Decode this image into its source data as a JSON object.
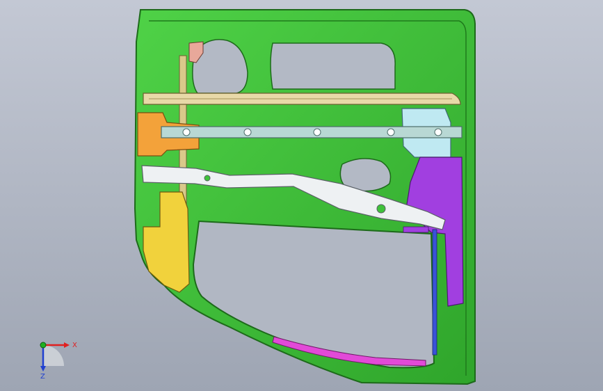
{
  "scene": {
    "background_top": "#c3c8d4",
    "background_bottom": "#9ea5b3",
    "door_inner_panel_color": "#3fc23a",
    "door_frame_color": "#2e9b2a",
    "crossbar_upper_color": "#e8d9a8",
    "crossbar_middle_color": "#b8d8d4",
    "reinforcement_orange_color": "#f3a23a",
    "reinforcement_yellow_color": "#f1d23c",
    "hinge_pillar_purple_color": "#a13fe0",
    "bracket_lightblue_color": "#bfe9f2",
    "beam_white_color": "#eef1f3",
    "lower_seal_magenta_color": "#e24ad8",
    "bracket_pink_color": "#e8a89a"
  },
  "triad": {
    "x_label": "X",
    "z_label": "Z",
    "x_icon": "x-axis-arrow-icon",
    "y_icon": "y-axis-dot-icon",
    "z_icon": "z-axis-arrow-icon",
    "x_color": "#e02020",
    "y_color": "#20b020",
    "z_color": "#2040d0"
  }
}
